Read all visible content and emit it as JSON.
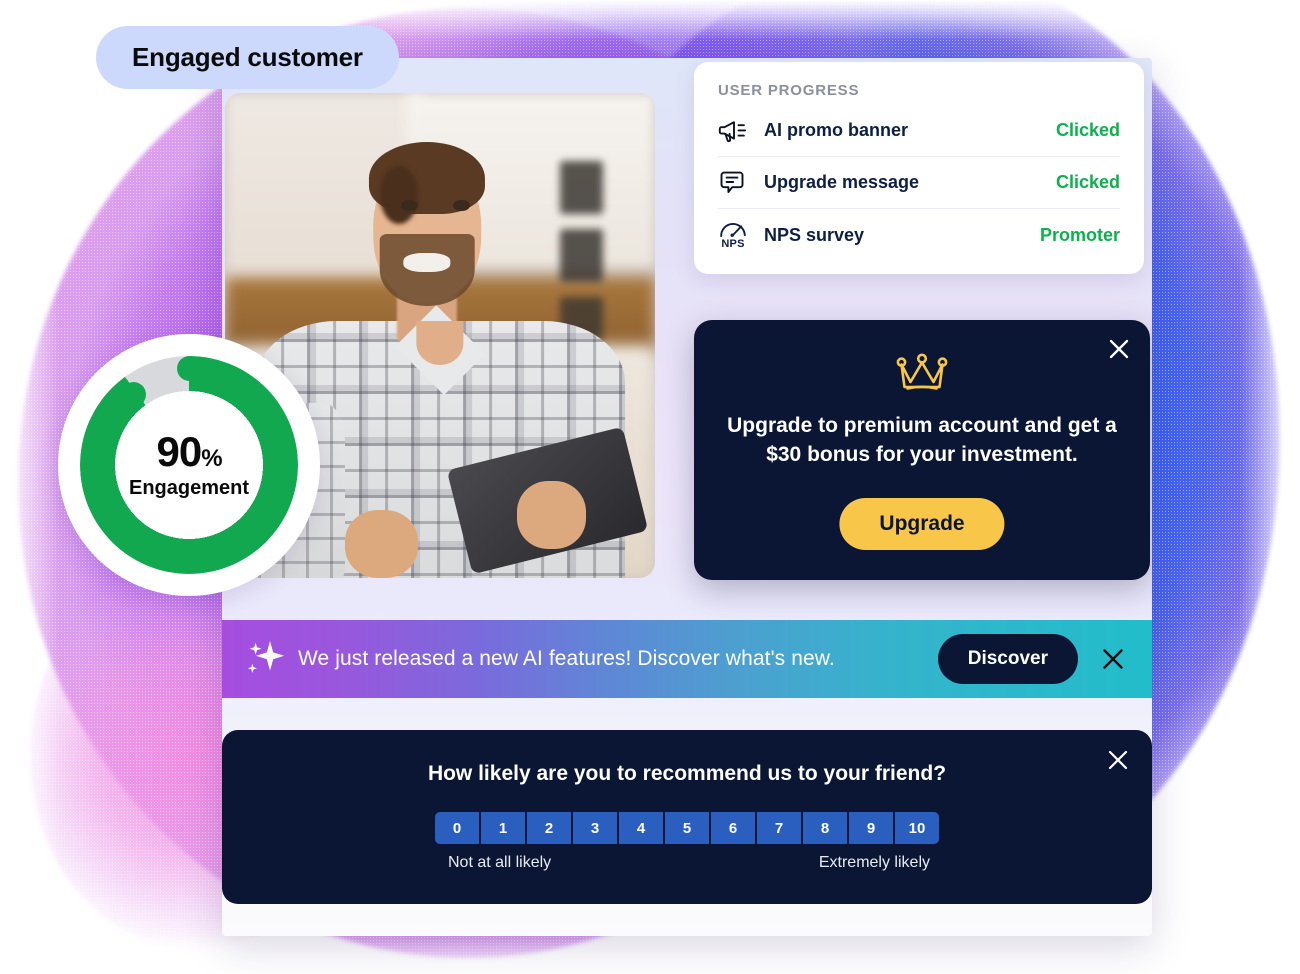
{
  "badge": {
    "label": "Engaged customer"
  },
  "engagement": {
    "value": "90",
    "symbol": "%",
    "label": "Engagement",
    "percent": 90,
    "ring_color": "#12a850",
    "track_color": "#d7d9dc"
  },
  "progress_card": {
    "title": "USER PROGRESS",
    "rows": [
      {
        "icon": "megaphone-icon",
        "label": "AI promo banner",
        "status": "Clicked"
      },
      {
        "icon": "chat-bubble-icon",
        "label": "Upgrade message",
        "status": "Clicked"
      },
      {
        "icon": "nps-gauge-icon",
        "label": "NPS survey",
        "status": "Promoter",
        "icon_text": "NPS"
      }
    ],
    "status_color": "#0cb14b"
  },
  "premium_card": {
    "icon": "crown-icon",
    "message": "Upgrade to premium account and get a $30 bonus for your investment.",
    "button_label": "Upgrade",
    "close_label": "close-icon",
    "bg_color": "#0a1633",
    "accent_color": "#f8c648"
  },
  "ai_banner": {
    "icon": "sparkle-icon",
    "message": "We just released a new AI features! Discover what's new.",
    "button_label": "Discover",
    "close_label": "close-icon",
    "gradient_from": "#a64de0",
    "gradient_to": "#22bdcb"
  },
  "nps_survey": {
    "question": "How likely are you to recommend us to your friend?",
    "scale": [
      "0",
      "1",
      "2",
      "3",
      "4",
      "5",
      "6",
      "7",
      "8",
      "9",
      "10"
    ],
    "left_label": "Not at all likely",
    "right_label": "Extremely likely",
    "bg_color": "#0a1633",
    "cell_color": "#2a5fc0"
  }
}
